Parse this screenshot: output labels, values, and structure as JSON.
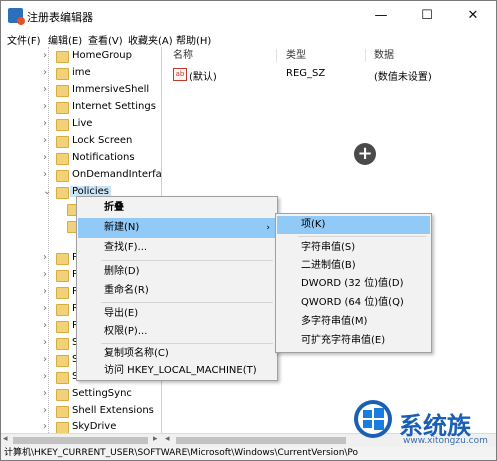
{
  "window": {
    "title": "注册表编辑器",
    "minimize_glyph": "—",
    "maximize_glyph": "☐",
    "close_glyph": "✕"
  },
  "menubar": {
    "file": "文件(F)",
    "edit": "编辑(E)",
    "view": "查看(V)",
    "favorites": "收藏夹(A)",
    "help": "帮助(H)"
  },
  "tree": {
    "items": [
      {
        "label": "HomeGroup",
        "expanded": false
      },
      {
        "label": "ime",
        "expanded": false
      },
      {
        "label": "ImmersiveShell",
        "expanded": false
      },
      {
        "label": "Internet Settings",
        "expanded": false
      },
      {
        "label": "Live",
        "expanded": false
      },
      {
        "label": "Lock Screen",
        "expanded": false
      },
      {
        "label": "Notifications",
        "expanded": false
      },
      {
        "label": "OnDemandInterfa",
        "expanded": false
      },
      {
        "label": "Policies",
        "expanded": true,
        "selected": true
      },
      {
        "label": "P",
        "expanded": false
      },
      {
        "label": "P",
        "expanded": false
      },
      {
        "label": "R",
        "expanded": false
      },
      {
        "label": "R",
        "expanded": false
      },
      {
        "label": "R",
        "expanded": false
      },
      {
        "label": "S",
        "expanded": false
      },
      {
        "label": "S",
        "expanded": false
      },
      {
        "label": "S",
        "expanded": false
      },
      {
        "label": "SettingSync",
        "expanded": false
      },
      {
        "label": "Shell Extensions",
        "expanded": false
      },
      {
        "label": "SkyDrive",
        "expanded": false
      }
    ]
  },
  "values_pane": {
    "headers": {
      "name": "名称",
      "type": "类型",
      "data": "数据"
    },
    "rows": [
      {
        "name": "(默认)",
        "type": "REG_SZ",
        "data": "(数值未设置)"
      }
    ],
    "plus_glyph": "+"
  },
  "context_menu": {
    "collapse": "折叠",
    "new": "新建(N)",
    "find": "查找(F)...",
    "delete": "删除(D)",
    "rename": "重命名(R)",
    "export": "导出(E)",
    "permissions": "权限(P)...",
    "copy_key_name": "复制项名称(C)",
    "visit_hklm": "访问 HKEY_LOCAL_MACHINE(T)",
    "submenu_arrow": "›"
  },
  "new_submenu": {
    "key": "项(K)",
    "string": "字符串值(S)",
    "binary": "二进制值(B)",
    "dword": "DWORD (32 位)值(D)",
    "qword": "QWORD (64 位)值(Q)",
    "multi_string": "多字符串值(M)",
    "expandable_string": "可扩充字符串值(E)"
  },
  "statusbar": {
    "path": "计算机\\HKEY_CURRENT_USER\\SOFTWARE\\Microsoft\\Windows\\CurrentVersion\\Po"
  },
  "scrollbar": {
    "left_arrow": "◂",
    "right_arrow": "▸"
  },
  "watermark": {
    "brand": "系统族",
    "url": "www.xitongzu.com"
  },
  "colors": {
    "selection": "#cce4f7",
    "menu_highlight": "#91c9f7",
    "folder": "#f1d27a",
    "watermark_blue": "#1a5fb4"
  }
}
